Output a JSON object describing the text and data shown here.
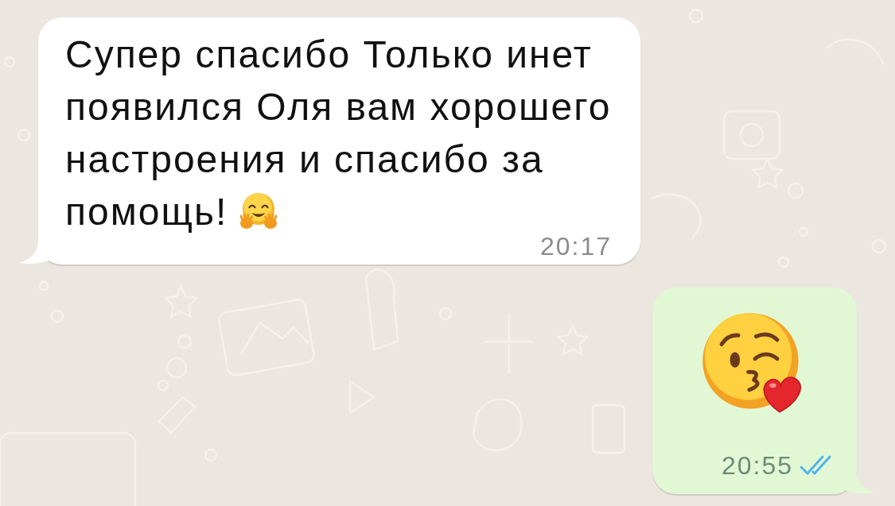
{
  "chat": {
    "messages": [
      {
        "outgoing": false,
        "kind": "text",
        "text": "Супер спасибо Только инет появился Оля вам хорошего настроения и спасибо за помощь!",
        "emoji": {
          "kind": "hug"
        },
        "time": "20:17"
      },
      {
        "outgoing": true,
        "kind": "emoji",
        "emoji": {
          "kind": "kiss"
        },
        "time": "20:55",
        "read": true
      }
    ]
  }
}
